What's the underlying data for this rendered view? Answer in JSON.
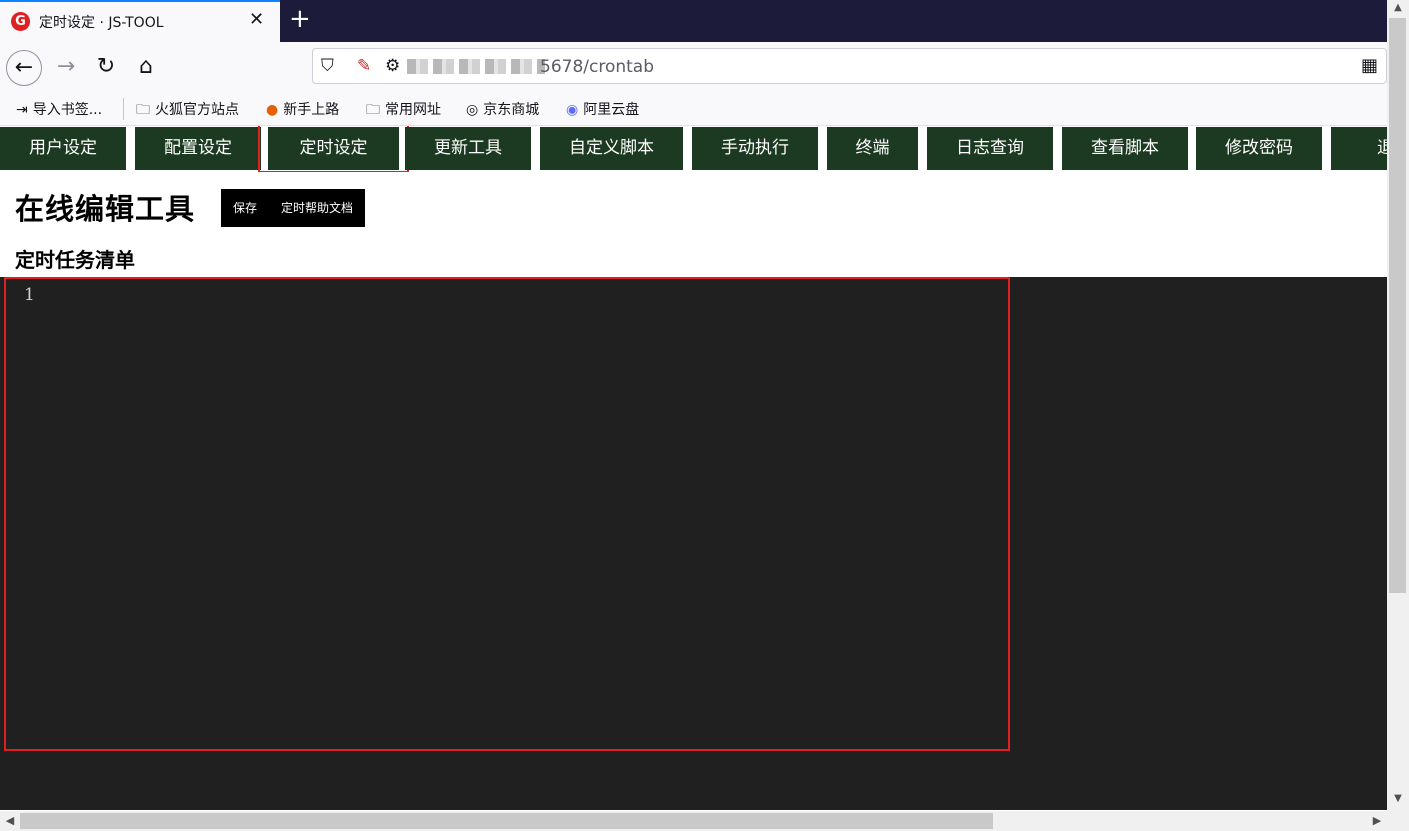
{
  "browser": {
    "tab_title": "定时设定 · JS-TOOL",
    "tab_favicon": "G",
    "url_visible": "5678/crontab",
    "bookmarks": [
      {
        "label": "导入书签...",
        "icon": "import-icon"
      },
      {
        "label": "火狐官方站点",
        "icon": "folder-icon"
      },
      {
        "label": "新手上路",
        "icon": "firefox-icon"
      },
      {
        "label": "常用网址",
        "icon": "folder-icon"
      },
      {
        "label": "京东商城",
        "icon": "globe-icon"
      },
      {
        "label": "阿里云盘",
        "icon": "aliyun-drive-icon"
      }
    ]
  },
  "menu": {
    "items": [
      {
        "label": "用户设定"
      },
      {
        "label": "配置设定"
      },
      {
        "label": "定时设定",
        "active": true
      },
      {
        "label": "更新工具"
      },
      {
        "label": "自定义脚本"
      },
      {
        "label": "手动执行"
      },
      {
        "label": "终端"
      },
      {
        "label": "日志查询"
      },
      {
        "label": "查看脚本"
      },
      {
        "label": "修改密码"
      },
      {
        "label": "退出"
      }
    ]
  },
  "page": {
    "title": "在线编辑工具",
    "save_label": "保存",
    "help_label": "定时帮助文档",
    "subtitle": "定时任务清单"
  },
  "editor": {
    "line_numbers": [
      "1"
    ],
    "content": ""
  },
  "colors": {
    "menu_bg": "#1c3a21",
    "editor_bg": "#202020",
    "highlight": "#e02020",
    "tab_accent": "#0a84ff"
  }
}
